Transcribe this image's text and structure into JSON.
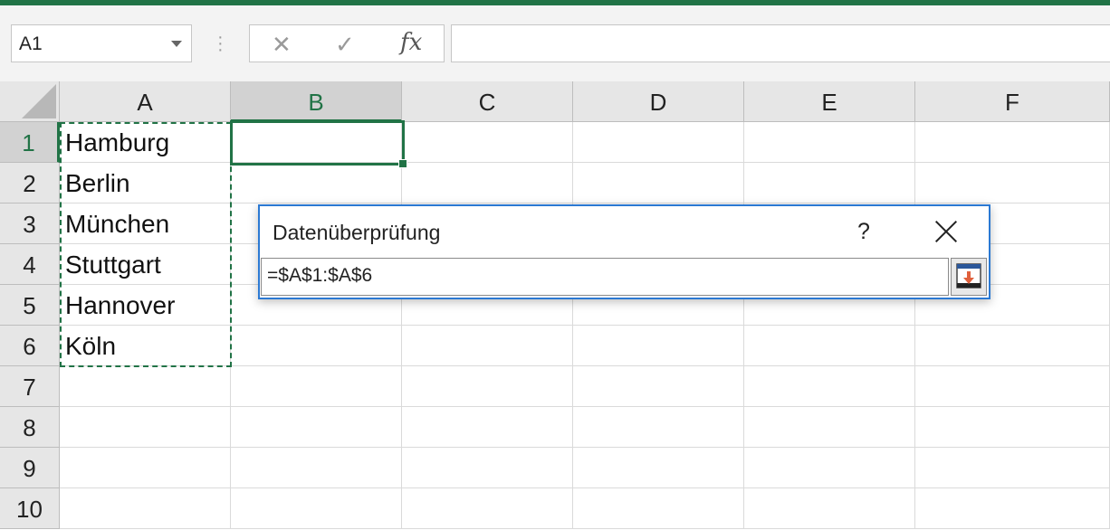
{
  "formula_bar": {
    "name_box": "A1",
    "formula": ""
  },
  "icons": {
    "cancel": "x-icon",
    "enter": "check-icon",
    "function": "fx-icon",
    "dropdown": "chevron-down-icon",
    "collapse": "collapse-dialog-icon",
    "close": "close-icon"
  },
  "colors": {
    "accent": "#217346",
    "dialog_border": "#2b79d3",
    "collapse_arrow": "#e0603c"
  },
  "grid": {
    "columns": [
      "A",
      "B",
      "C",
      "D",
      "E",
      "F"
    ],
    "rows": [
      "1",
      "2",
      "3",
      "4",
      "5",
      "6",
      "7",
      "8",
      "9",
      "10"
    ],
    "selected_column": "B",
    "selected_row": "1",
    "column_a_values": [
      "Hamburg",
      "Berlin",
      "München",
      "Stuttgart",
      "Hannover",
      "Köln"
    ]
  },
  "dialog": {
    "title": "Datenüberprüfung",
    "help": "?",
    "reference": "=$A$1:$A$6"
  }
}
